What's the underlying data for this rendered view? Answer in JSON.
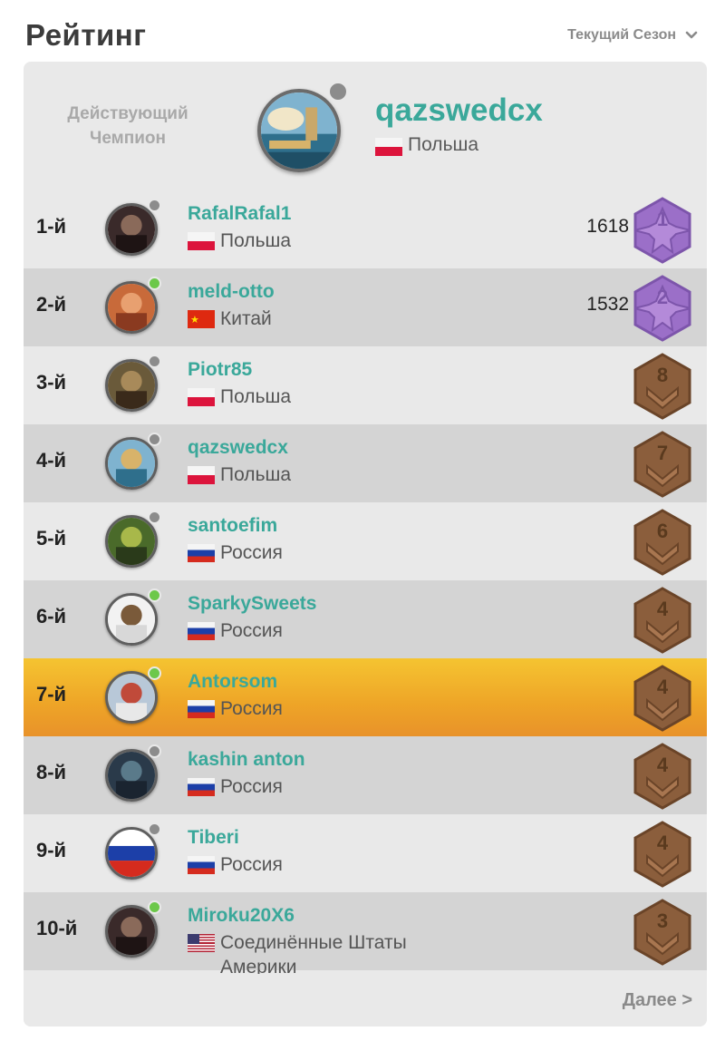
{
  "header": {
    "title": "Рейтинг",
    "season_label": "Текущий Сезон"
  },
  "champion": {
    "label_line1": "Действующий",
    "label_line2": "Чемпион",
    "name": "qazswedcx",
    "country": "Польша",
    "status": "offline"
  },
  "rows": [
    {
      "rank": "1-й",
      "name": "RafalRafal1",
      "country": "Польша",
      "flag": "pl",
      "score": "1618",
      "status": "offline",
      "badge": {
        "type": "purple",
        "level": "1"
      },
      "shade": "light"
    },
    {
      "rank": "2-й",
      "name": "meld-otto",
      "country": "Китай",
      "flag": "cn",
      "score": "1532",
      "status": "online",
      "badge": {
        "type": "purple",
        "level": "2"
      },
      "shade": "dark"
    },
    {
      "rank": "3-й",
      "name": "Piotr85",
      "country": "Польша",
      "flag": "pl",
      "score": "",
      "status": "offline",
      "badge": {
        "type": "bronze",
        "level": "8"
      },
      "shade": "light"
    },
    {
      "rank": "4-й",
      "name": "qazswedcx",
      "country": "Польша",
      "flag": "pl",
      "score": "",
      "status": "offline",
      "badge": {
        "type": "bronze",
        "level": "7"
      },
      "shade": "dark"
    },
    {
      "rank": "5-й",
      "name": "santoefim",
      "country": "Россия",
      "flag": "ru",
      "score": "",
      "status": "offline",
      "badge": {
        "type": "bronze",
        "level": "6"
      },
      "shade": "light"
    },
    {
      "rank": "6-й",
      "name": "SparkySweets",
      "country": "Россия",
      "flag": "ru",
      "score": "",
      "status": "online",
      "badge": {
        "type": "bronze",
        "level": "4"
      },
      "shade": "dark"
    },
    {
      "rank": "7-й",
      "name": "Antorsom",
      "country": "Россия",
      "flag": "ru",
      "score": "",
      "status": "online",
      "badge": {
        "type": "bronze",
        "level": "4"
      },
      "shade": "highlight"
    },
    {
      "rank": "8-й",
      "name": "kashin anton",
      "country": "Россия",
      "flag": "ru",
      "score": "",
      "status": "offline",
      "badge": {
        "type": "bronze",
        "level": "4"
      },
      "shade": "dark"
    },
    {
      "rank": "9-й",
      "name": "Tiberi",
      "country": "Россия",
      "flag": "ru",
      "score": "",
      "status": "offline",
      "badge": {
        "type": "bronze",
        "level": "4"
      },
      "shade": "light"
    },
    {
      "rank": "10-й",
      "name": "Miroku20X6",
      "country": "Соединённые Штаты Америки",
      "flag": "us",
      "score": "",
      "status": "online",
      "badge": {
        "type": "bronze",
        "level": "3"
      },
      "shade": "dark"
    }
  ],
  "footer": {
    "more_label": "Далее >"
  },
  "colors": {
    "username": "#3aa89a",
    "highlight": "#f0b02c",
    "online": "#6cc84a",
    "offline": "#8c8c8c",
    "badge_purple": "#9b6fc8",
    "badge_bronze": "#8b5e3c"
  },
  "icons": {
    "season_dropdown": "chevron-down-icon",
    "status": "status-dot-icon",
    "rank_badge": "rank-badge-icon"
  }
}
